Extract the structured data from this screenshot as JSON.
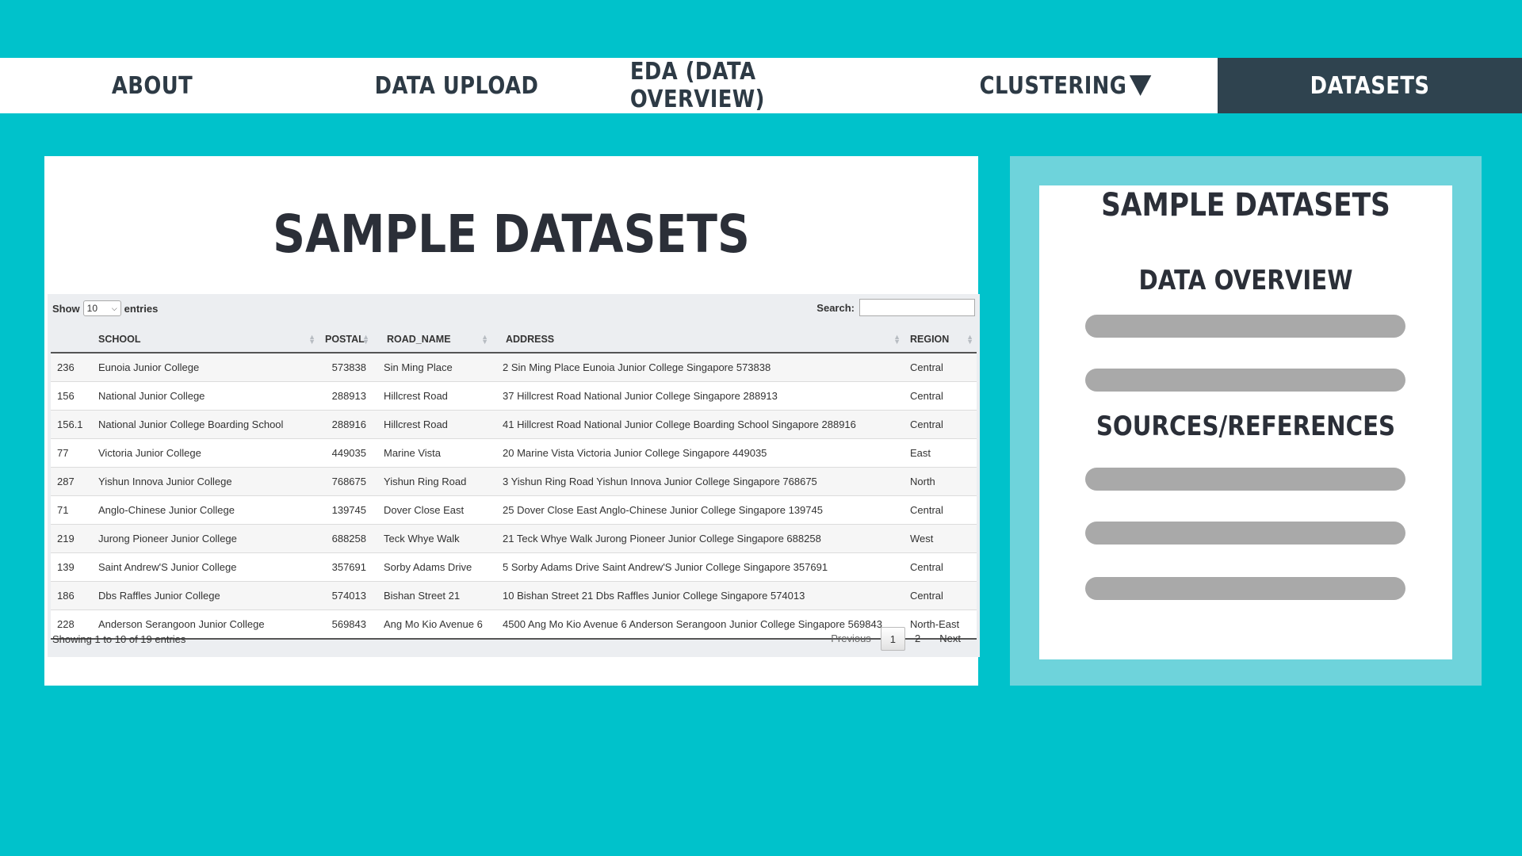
{
  "nav": {
    "items": [
      {
        "label": "ABOUT"
      },
      {
        "label": "DATA UPLOAD"
      },
      {
        "label": "EDA (DATA OVERVIEW)"
      },
      {
        "label": "CLUSTERING"
      },
      {
        "label": "DATASETS"
      }
    ],
    "active": "DATASETS"
  },
  "main": {
    "title": "SAMPLE DATASETS",
    "length_prefix": "Show",
    "length_value": "10",
    "length_suffix": "entries",
    "search_label": "Search:",
    "search_value": "",
    "columns": [
      "",
      "SCHOOL",
      "POSTAL",
      "ROAD_NAME",
      "ADDRESS",
      "REGION"
    ],
    "rows": [
      [
        "236",
        "Eunoia Junior College",
        "573838",
        "Sin Ming Place",
        "2 Sin Ming Place Eunoia Junior College Singapore 573838",
        "Central"
      ],
      [
        "156",
        "National Junior College",
        "288913",
        "Hillcrest Road",
        "37 Hillcrest Road National Junior College Singapore 288913",
        "Central"
      ],
      [
        "156.1",
        "National Junior College Boarding School",
        "288916",
        "Hillcrest Road",
        "41 Hillcrest Road National Junior College Boarding School Singapore 288916",
        "Central"
      ],
      [
        "77",
        "Victoria Junior College",
        "449035",
        "Marine Vista",
        "20 Marine Vista Victoria Junior College Singapore 449035",
        "East"
      ],
      [
        "287",
        "Yishun Innova Junior College",
        "768675",
        "Yishun Ring Road",
        "3 Yishun Ring Road Yishun Innova Junior College Singapore 768675",
        "North"
      ],
      [
        "71",
        "Anglo-Chinese Junior College",
        "139745",
        "Dover Close East",
        "25 Dover Close East Anglo-Chinese Junior College Singapore 139745",
        "Central"
      ],
      [
        "219",
        "Jurong Pioneer Junior College",
        "688258",
        "Teck Whye Walk",
        "21 Teck Whye Walk Jurong Pioneer Junior College Singapore 688258",
        "West"
      ],
      [
        "139",
        "Saint Andrew'S Junior College",
        "357691",
        "Sorby Adams Drive",
        "5 Sorby Adams Drive Saint Andrew'S Junior College Singapore 357691",
        "Central"
      ],
      [
        "186",
        "Dbs Raffles Junior College",
        "574013",
        "Bishan Street 21",
        "10 Bishan Street 21 Dbs Raffles Junior College Singapore 574013",
        "Central"
      ],
      [
        "228",
        "Anderson Serangoon Junior College",
        "569843",
        "Ang Mo Kio Avenue 6",
        "4500 Ang Mo Kio Avenue 6 Anderson Serangoon Junior College Singapore 569843",
        "North-East"
      ]
    ],
    "info": "Showing 1 to 10 of 19 entries",
    "paging": {
      "previous": "Previous",
      "pages": [
        "1",
        "2"
      ],
      "current": "1",
      "next": "Next"
    }
  },
  "side": {
    "title": "SAMPLE DATASETS",
    "section1": "DATA OVERVIEW",
    "section2": "SOURCES/REFERENCES"
  },
  "colors": {
    "background": "#00c2cb",
    "nav_active": "#2f434f",
    "side_frame": "#6ed3db",
    "placeholder_bar": "#a9a9a9"
  }
}
